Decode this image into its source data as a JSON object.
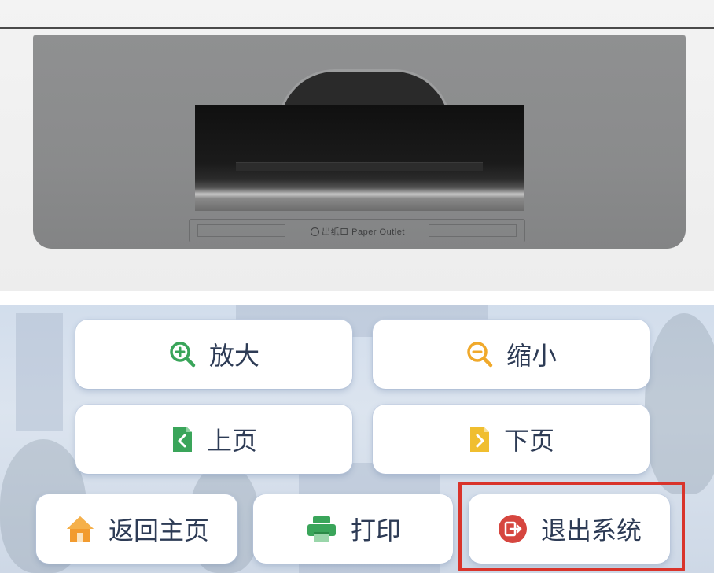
{
  "printer": {
    "outlet_label": "出纸口 Paper Outlet"
  },
  "buttons": {
    "zoom_in": {
      "label": "放大",
      "icon": "zoom-in-icon",
      "color": "#3aa55a"
    },
    "zoom_out": {
      "label": "缩小",
      "icon": "zoom-out-icon",
      "color": "#f0a92b"
    },
    "prev_page": {
      "label": "上页",
      "icon": "prev-page-icon",
      "color": "#3aa55a"
    },
    "next_page": {
      "label": "下页",
      "icon": "next-page-icon",
      "color": "#f0be2f"
    },
    "home": {
      "label": "返回主页",
      "icon": "home-icon",
      "color": "#f29b2f"
    },
    "print": {
      "label": "打印",
      "icon": "printer-icon",
      "color": "#3aa55a"
    },
    "exit": {
      "label": "退出系统",
      "icon": "exit-icon",
      "color": "#d6463f"
    }
  },
  "highlight": {
    "color": "#d9342b",
    "target": "exit"
  }
}
